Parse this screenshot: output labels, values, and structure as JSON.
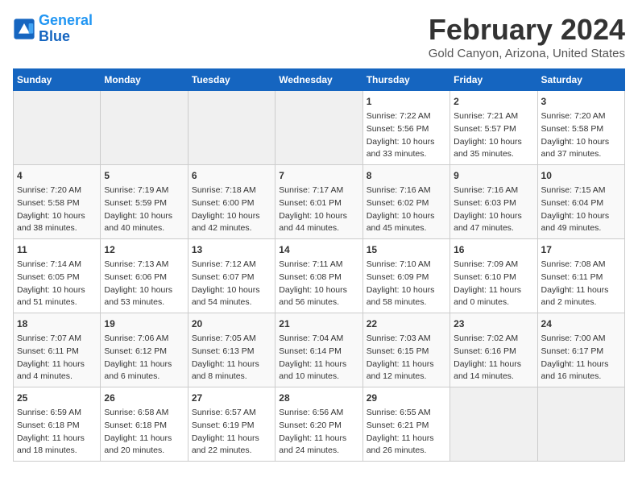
{
  "logo": {
    "line1": "General",
    "line2": "Blue"
  },
  "header": {
    "title": "February 2024",
    "subtitle": "Gold Canyon, Arizona, United States"
  },
  "days_of_week": [
    "Sunday",
    "Monday",
    "Tuesday",
    "Wednesday",
    "Thursday",
    "Friday",
    "Saturday"
  ],
  "weeks": [
    [
      {
        "day": "",
        "content": ""
      },
      {
        "day": "",
        "content": ""
      },
      {
        "day": "",
        "content": ""
      },
      {
        "day": "",
        "content": ""
      },
      {
        "day": "1",
        "content": "Sunrise: 7:22 AM\nSunset: 5:56 PM\nDaylight: 10 hours\nand 33 minutes."
      },
      {
        "day": "2",
        "content": "Sunrise: 7:21 AM\nSunset: 5:57 PM\nDaylight: 10 hours\nand 35 minutes."
      },
      {
        "day": "3",
        "content": "Sunrise: 7:20 AM\nSunset: 5:58 PM\nDaylight: 10 hours\nand 37 minutes."
      }
    ],
    [
      {
        "day": "4",
        "content": "Sunrise: 7:20 AM\nSunset: 5:58 PM\nDaylight: 10 hours\nand 38 minutes."
      },
      {
        "day": "5",
        "content": "Sunrise: 7:19 AM\nSunset: 5:59 PM\nDaylight: 10 hours\nand 40 minutes."
      },
      {
        "day": "6",
        "content": "Sunrise: 7:18 AM\nSunset: 6:00 PM\nDaylight: 10 hours\nand 42 minutes."
      },
      {
        "day": "7",
        "content": "Sunrise: 7:17 AM\nSunset: 6:01 PM\nDaylight: 10 hours\nand 44 minutes."
      },
      {
        "day": "8",
        "content": "Sunrise: 7:16 AM\nSunset: 6:02 PM\nDaylight: 10 hours\nand 45 minutes."
      },
      {
        "day": "9",
        "content": "Sunrise: 7:16 AM\nSunset: 6:03 PM\nDaylight: 10 hours\nand 47 minutes."
      },
      {
        "day": "10",
        "content": "Sunrise: 7:15 AM\nSunset: 6:04 PM\nDaylight: 10 hours\nand 49 minutes."
      }
    ],
    [
      {
        "day": "11",
        "content": "Sunrise: 7:14 AM\nSunset: 6:05 PM\nDaylight: 10 hours\nand 51 minutes."
      },
      {
        "day": "12",
        "content": "Sunrise: 7:13 AM\nSunset: 6:06 PM\nDaylight: 10 hours\nand 53 minutes."
      },
      {
        "day": "13",
        "content": "Sunrise: 7:12 AM\nSunset: 6:07 PM\nDaylight: 10 hours\nand 54 minutes."
      },
      {
        "day": "14",
        "content": "Sunrise: 7:11 AM\nSunset: 6:08 PM\nDaylight: 10 hours\nand 56 minutes."
      },
      {
        "day": "15",
        "content": "Sunrise: 7:10 AM\nSunset: 6:09 PM\nDaylight: 10 hours\nand 58 minutes."
      },
      {
        "day": "16",
        "content": "Sunrise: 7:09 AM\nSunset: 6:10 PM\nDaylight: 11 hours\nand 0 minutes."
      },
      {
        "day": "17",
        "content": "Sunrise: 7:08 AM\nSunset: 6:11 PM\nDaylight: 11 hours\nand 2 minutes."
      }
    ],
    [
      {
        "day": "18",
        "content": "Sunrise: 7:07 AM\nSunset: 6:11 PM\nDaylight: 11 hours\nand 4 minutes."
      },
      {
        "day": "19",
        "content": "Sunrise: 7:06 AM\nSunset: 6:12 PM\nDaylight: 11 hours\nand 6 minutes."
      },
      {
        "day": "20",
        "content": "Sunrise: 7:05 AM\nSunset: 6:13 PM\nDaylight: 11 hours\nand 8 minutes."
      },
      {
        "day": "21",
        "content": "Sunrise: 7:04 AM\nSunset: 6:14 PM\nDaylight: 11 hours\nand 10 minutes."
      },
      {
        "day": "22",
        "content": "Sunrise: 7:03 AM\nSunset: 6:15 PM\nDaylight: 11 hours\nand 12 minutes."
      },
      {
        "day": "23",
        "content": "Sunrise: 7:02 AM\nSunset: 6:16 PM\nDaylight: 11 hours\nand 14 minutes."
      },
      {
        "day": "24",
        "content": "Sunrise: 7:00 AM\nSunset: 6:17 PM\nDaylight: 11 hours\nand 16 minutes."
      }
    ],
    [
      {
        "day": "25",
        "content": "Sunrise: 6:59 AM\nSunset: 6:18 PM\nDaylight: 11 hours\nand 18 minutes."
      },
      {
        "day": "26",
        "content": "Sunrise: 6:58 AM\nSunset: 6:18 PM\nDaylight: 11 hours\nand 20 minutes."
      },
      {
        "day": "27",
        "content": "Sunrise: 6:57 AM\nSunset: 6:19 PM\nDaylight: 11 hours\nand 22 minutes."
      },
      {
        "day": "28",
        "content": "Sunrise: 6:56 AM\nSunset: 6:20 PM\nDaylight: 11 hours\nand 24 minutes."
      },
      {
        "day": "29",
        "content": "Sunrise: 6:55 AM\nSunset: 6:21 PM\nDaylight: 11 hours\nand 26 minutes."
      },
      {
        "day": "",
        "content": ""
      },
      {
        "day": "",
        "content": ""
      }
    ]
  ]
}
